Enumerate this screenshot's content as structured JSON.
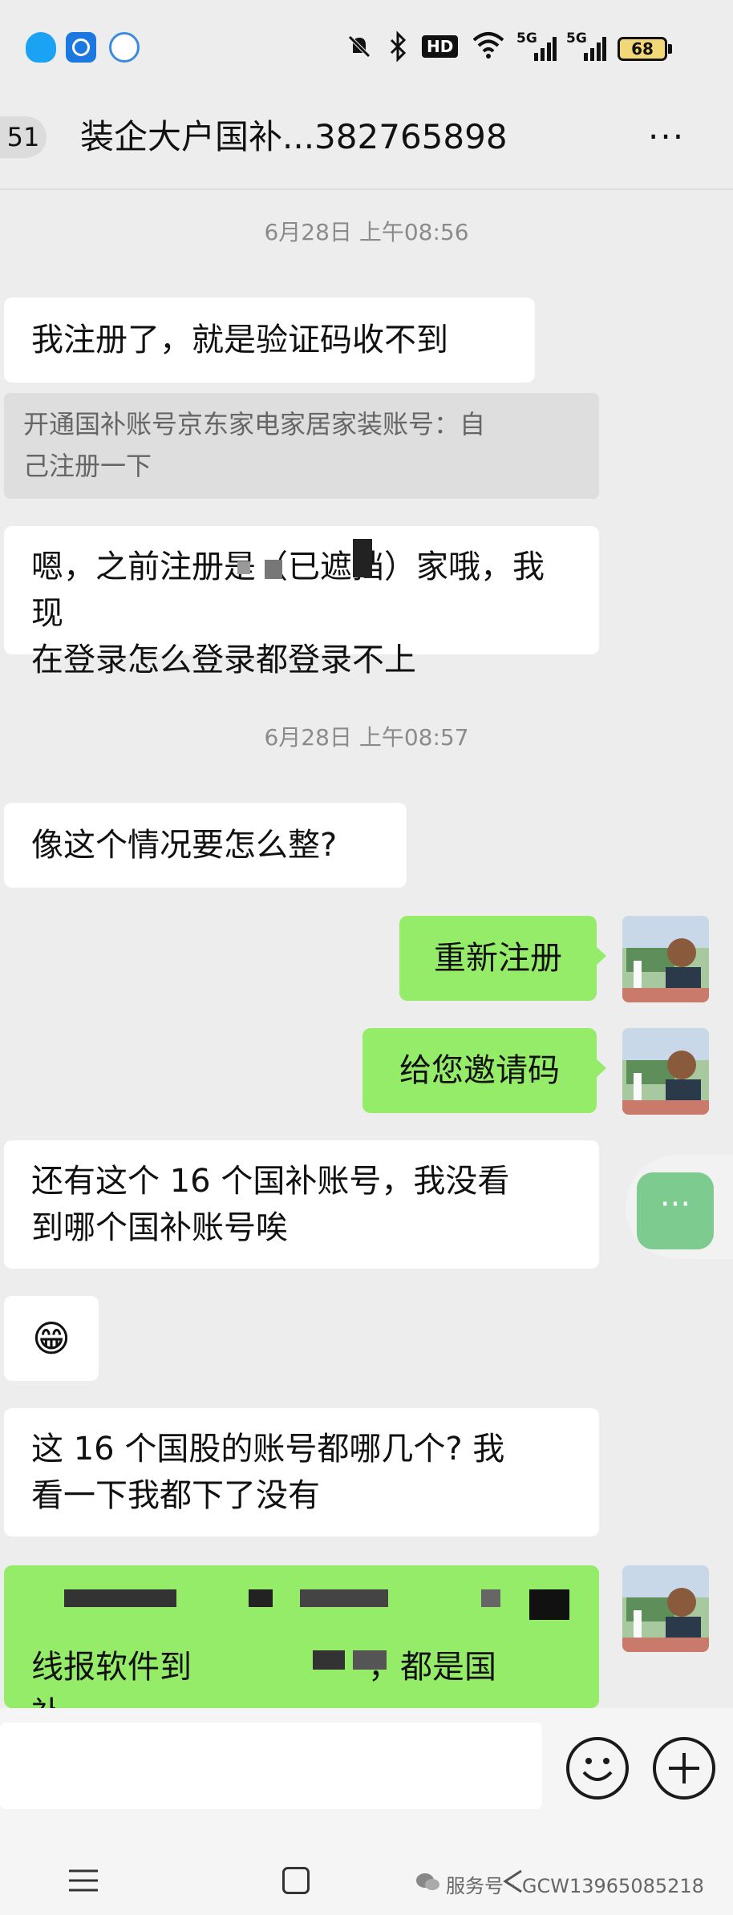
{
  "status_bar": {
    "hd_label": "HD",
    "net1_label": "5G",
    "net2_label": "5G",
    "battery": "68"
  },
  "header": {
    "unread_count": "51",
    "title": "装企大户国补...382765898",
    "more_label": "···"
  },
  "messages": {
    "time1": "6月28日 上午08:56",
    "m1": "我注册了，就是验证码收不到",
    "quote_line1": "开通国补账号京东家电家居家装账号：自",
    "quote_line2": "己注册一下",
    "m2_line1": "嗯，之前注册是（已遮挡）家哦，我现",
    "m2_line2": "在登录怎么登录都登录不上",
    "time2": "6月28日 上午08:57",
    "m3": "像这个情况要怎么整?",
    "m4": "重新注册",
    "m5": "给您邀请码",
    "m6_line1": "还有这个 16 个国补账号，我没看",
    "m6_line2": "到哪个国补账号唉",
    "m7_emoji": "😁",
    "m8_line1": "这 16 个国股的账号都哪几个? 我",
    "m8_line2": "看一下我都下了没有",
    "m9_line1": "线报软件到",
    "m9_line1_end": "，都是国",
    "m9_line2": "补"
  },
  "floating_button_label": "···",
  "footer": {
    "watermark": "服务号 · GCW13965085218"
  },
  "colors": {
    "background": "#ededed",
    "bubble_in": "#ffffff",
    "bubble_out": "#95ec69",
    "quote_bg": "#dedede"
  }
}
